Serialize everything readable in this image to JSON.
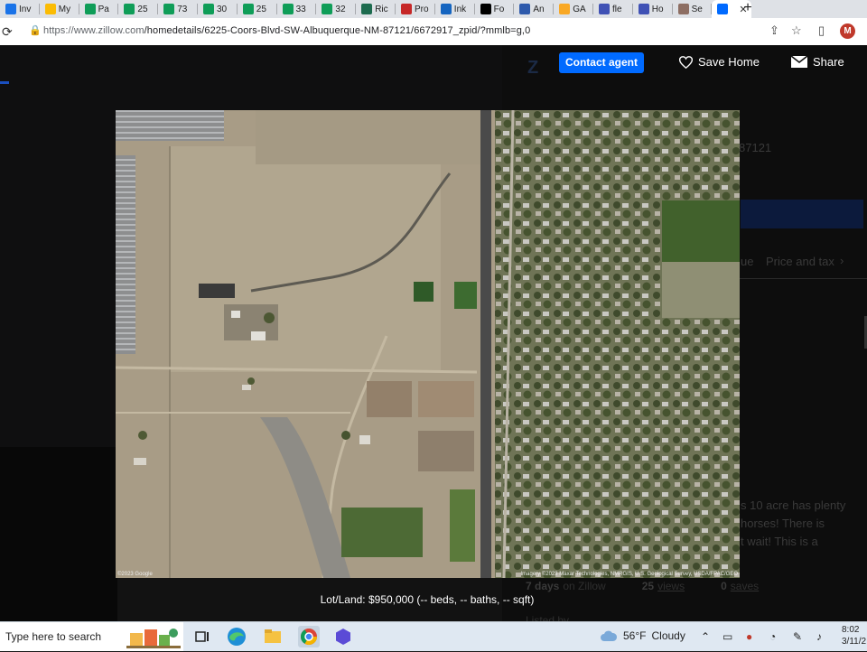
{
  "browser": {
    "tabs": [
      {
        "label": "Inv",
        "icon": "google-sheets-icon",
        "color": "#1a73e8"
      },
      {
        "label": "My",
        "icon": "google-drive-icon",
        "color": "#fbbc04"
      },
      {
        "label": "Pa",
        "icon": "google-sheets-icon",
        "color": "#0f9d58"
      },
      {
        "label": "25",
        "icon": "google-sheets-icon",
        "color": "#0f9d58"
      },
      {
        "label": "73",
        "icon": "google-sheets-icon",
        "color": "#0f9d58"
      },
      {
        "label": "30",
        "icon": "google-sheets-icon",
        "color": "#0f9d58"
      },
      {
        "label": "25",
        "icon": "google-sheets-icon",
        "color": "#0f9d58"
      },
      {
        "label": "33",
        "icon": "google-sheets-icon",
        "color": "#0f9d58"
      },
      {
        "label": "32",
        "icon": "google-sheets-icon",
        "color": "#0f9d58"
      },
      {
        "label": "Ric",
        "icon": "v-logo-icon",
        "color": "#1d6b4f"
      },
      {
        "label": "Pro",
        "icon": "flag-icon",
        "color": "#c62828"
      },
      {
        "label": "Ink",
        "icon": "ink-logo-icon",
        "color": "#1565c0"
      },
      {
        "label": "Fo",
        "icon": "x-logo-icon",
        "color": "#000000"
      },
      {
        "label": "An",
        "icon": "app-icon",
        "color": "#2e5aac"
      },
      {
        "label": "GA",
        "icon": "ga-icon",
        "color": "#f9a825"
      },
      {
        "label": "fle",
        "icon": "compass-icon",
        "color": "#3f51b5"
      },
      {
        "label": "Ho",
        "icon": "compass-icon",
        "color": "#3f51b5"
      },
      {
        "label": "Se",
        "icon": "image-icon",
        "color": "#8d6e63"
      },
      {
        "label": "",
        "icon": "zillow-icon",
        "color": "#006aff",
        "active": true
      }
    ],
    "url_main": "https://www.zillow.com",
    "url_rest": "/homedetails/6225-Coors-Blvd-SW-Albuquerque-NM-87121/6672917_zpid/?mmlb=g,0",
    "profile_initial": "M"
  },
  "overlay": {
    "contact_label": "Contact agent",
    "save_label": "Save Home",
    "share_label": "Share",
    "caption": "Lot/Land: $950,000 (-- beds, -- baths, -- sqft)",
    "credit_left": "©2023 Google",
    "credit_right": "Imagery ©2023 Maxar Technologies, NMRGIS, U.S. Geological Survey, USDA/FPAC/GEO"
  },
  "background": {
    "zip_fragment": "87121",
    "tab_value_fragment": "ue",
    "tab_price_tax": "Price and tax",
    "desc_line1": "s 10 acre has plenty",
    "desc_line2": "horses! There is",
    "desc_line3": "t wait!  This is a",
    "stats": [
      {
        "value": "7 days",
        "label": "on Zillow"
      },
      {
        "value": "25",
        "label": "views"
      },
      {
        "value": "0",
        "label": "saves"
      }
    ],
    "listed_by": "Listed by"
  },
  "taskbar": {
    "search_placeholder": "Type here to search",
    "weather_temp": "56°F",
    "weather_desc": "Cloudy",
    "time": "8:02",
    "date": "3/11/2"
  },
  "colors": {
    "accent": "#006aff",
    "tab_active": "#ffffff",
    "tab_bar": "#dee1e6"
  }
}
